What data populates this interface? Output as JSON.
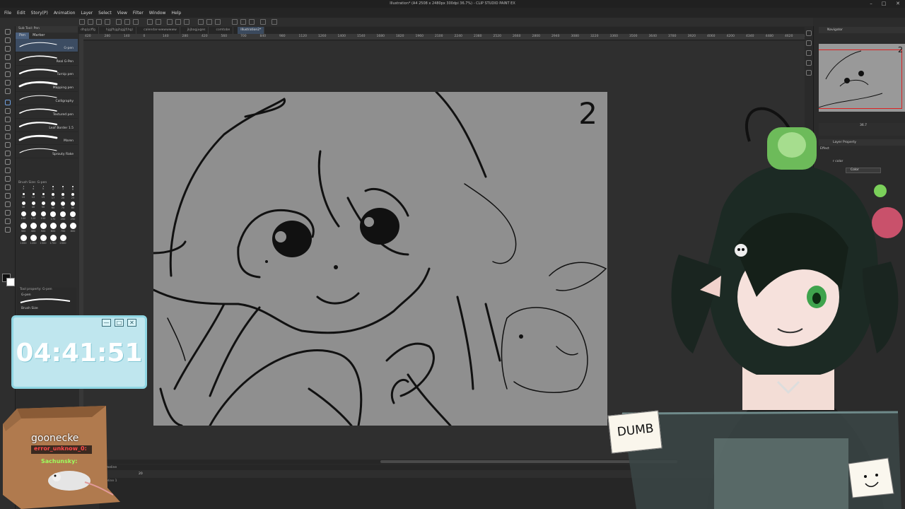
{
  "window": {
    "title": "Illustration* (A4 2508 x 2480px 300dpi 36.7%) - CLIP STUDIO PAINT EX",
    "minimize": "–",
    "maximize": "□",
    "close": "✕"
  },
  "menu": [
    "File",
    "Edit",
    "Story(P)",
    "Animation",
    "Layer",
    "Select",
    "View",
    "Filter",
    "Window",
    "Help"
  ],
  "tabs": [
    {
      "label": "dhg(p)ffg",
      "active": false
    },
    {
      "label": "hjgjfhjgjhjgjjf(hg)",
      "active": false
    },
    {
      "label": "calendar-wwwwwww",
      "active": false
    },
    {
      "label": "jkjbagjuges",
      "active": false
    },
    {
      "label": "comtobe",
      "active": false
    },
    {
      "label": "Illustration2*",
      "active": true
    }
  ],
  "ruler_ticks": [
    "420",
    "280",
    "140",
    "0",
    "140",
    "280",
    "420",
    "560",
    "700",
    "840",
    "980",
    "1120",
    "1260",
    "1400",
    "1540",
    "1680",
    "1820",
    "1960",
    "2100",
    "2240",
    "2380",
    "2520",
    "2660",
    "2800",
    "2940",
    "3080",
    "3220",
    "3360",
    "3500",
    "3640",
    "3780",
    "3920",
    "4060",
    "4200",
    "4340",
    "4480",
    "4620",
    "4760"
  ],
  "subtool": {
    "header": "Sub Tool: Pen",
    "tabs": [
      {
        "label": "Pen",
        "active": true
      },
      {
        "label": "Marker",
        "active": false
      }
    ],
    "brushes": [
      {
        "label": "G-pen",
        "active": true
      },
      {
        "label": "Real G-Pen",
        "active": false
      },
      {
        "label": "Turnip pen",
        "active": false
      },
      {
        "label": "Mapping pen",
        "active": false
      },
      {
        "label": "Calligraphy",
        "active": false
      },
      {
        "label": "Textured pen",
        "active": false
      },
      {
        "label": "Leaf Border 1.5",
        "active": false
      },
      {
        "label": "Maren",
        "active": false
      },
      {
        "label": "Sprouty Rake",
        "active": false
      }
    ]
  },
  "brush_size": {
    "header": "Brush Size: G-pen",
    "sizes": [
      "3",
      "4",
      "5",
      "6",
      "7",
      "8",
      "10",
      "12",
      "15",
      "17",
      "20",
      "25",
      "30",
      "40",
      "50",
      "60",
      "70",
      "80",
      "100",
      "120",
      "150",
      "170",
      "200",
      "250",
      "300",
      "400",
      "500",
      "600",
      "700",
      "800",
      "1000",
      "1200",
      "1500",
      "1700",
      "2000"
    ]
  },
  "tool_property": {
    "header": "Tool property: G-pen",
    "name": "G-pen",
    "row": "Brush Size"
  },
  "canvas": {
    "page_number": "2"
  },
  "timeline": {
    "header": "Timeline",
    "track": "Timeline 1",
    "frame": "20"
  },
  "navigator": {
    "header": "Navigator",
    "zoom": "36.7",
    "page_number": "2"
  },
  "layer_property": {
    "header": "Layer Property",
    "effect": "Effect",
    "layer_color": "r color",
    "color_select": "Color"
  },
  "timer": {
    "time": "04:41:51",
    "buttons": [
      "—",
      "□",
      "✕"
    ]
  },
  "chat": {
    "title": "goonecke",
    "user1": "error_unknow_0:",
    "user2": "Sachunsky:"
  },
  "notes": {
    "dumb": "DUMB"
  },
  "colors": {
    "accent": "#4a5f7c",
    "timer_bg": "#bfe6ee",
    "timer_border": "#8fd6e3",
    "user1": "#ff4a4a",
    "user2": "#9dff5e"
  }
}
